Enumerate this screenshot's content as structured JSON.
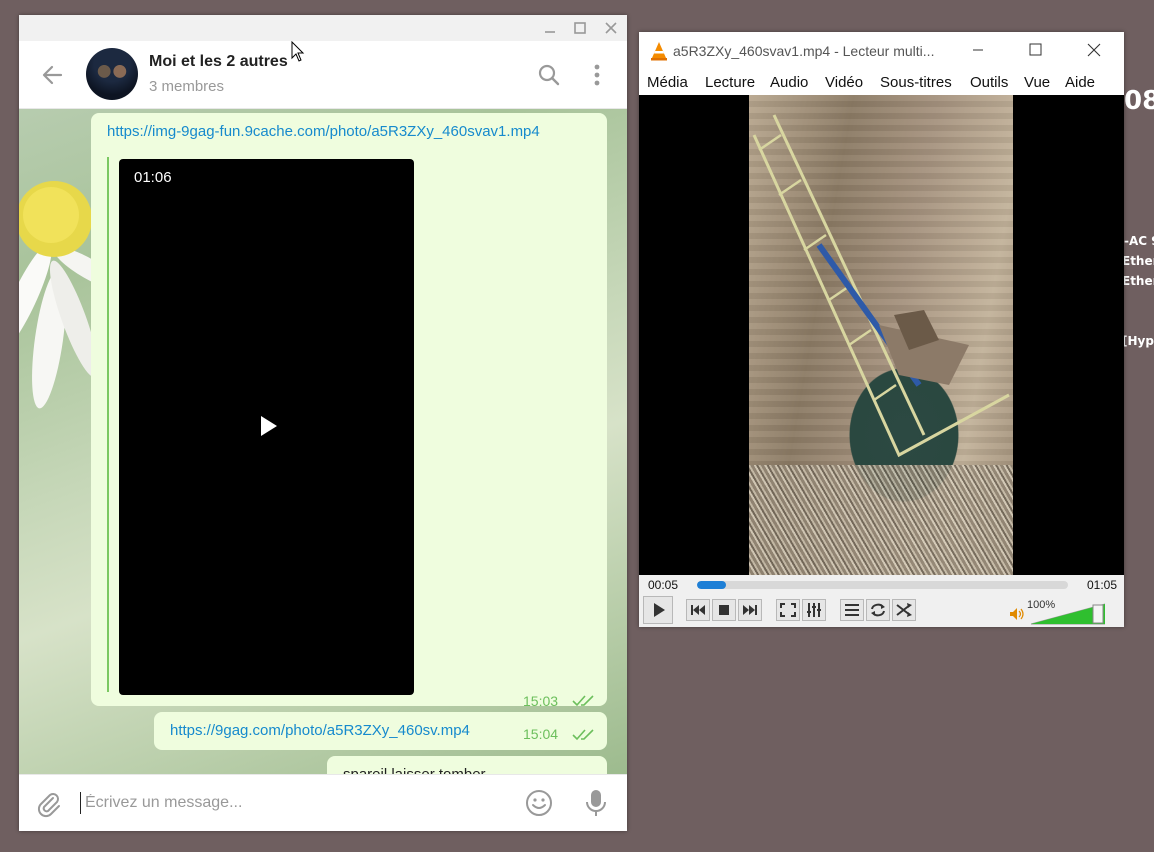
{
  "telegram": {
    "chat_title": "Moi et les 2 autres",
    "chat_subtitle": "3 membres",
    "messages": [
      {
        "link": "https://img-9gag-fun.9cache.com/photo/a5R3ZXy_460svav1.mp4",
        "video_duration": "01:06",
        "time": "15:03"
      },
      {
        "link": "https://9gag.com/photo/a5R3ZXy_460sv.mp4",
        "time": "15:04"
      },
      {
        "text": "spareil laisser tomber"
      }
    ],
    "composer_placeholder": "Écrivez un message...",
    "accent_color": "#168acd",
    "bubble_color": "#effdde"
  },
  "vlc": {
    "title": "a5R3ZXy_460svav1.mp4 - Lecteur multi...",
    "menu": [
      {
        "label": "Média"
      },
      {
        "label": "Lecture"
      },
      {
        "label": "Audio"
      },
      {
        "label": "Vidéo"
      },
      {
        "label": "Sous-titres"
      },
      {
        "label": "Outils"
      },
      {
        "label": "Vue"
      },
      {
        "label": "Aide"
      }
    ],
    "current_time": "00:05",
    "total_time": "01:05",
    "progress_fraction": 0.077,
    "volume_label": "100%",
    "volume_fraction": 1.0,
    "progress_color": "#1e7fd6"
  },
  "desktop": {
    "fragments": [
      "08",
      "-AC 9",
      "Ether",
      "Ether",
      "[Hype"
    ]
  }
}
